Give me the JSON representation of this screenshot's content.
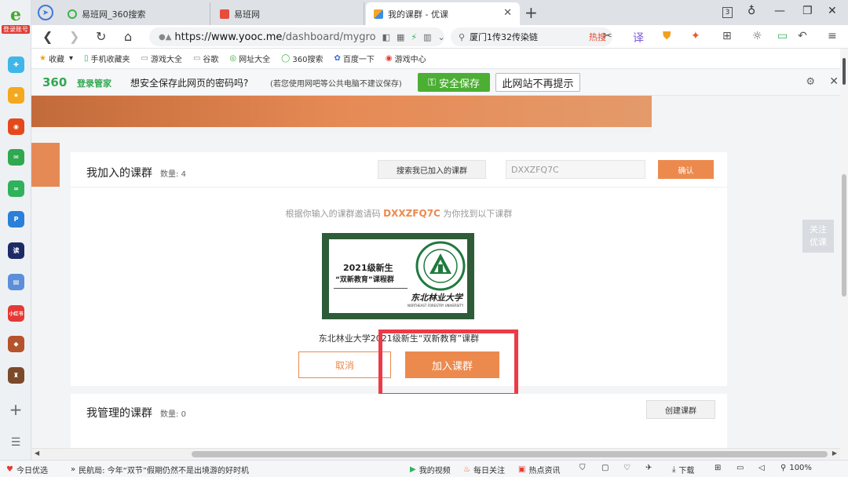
{
  "sidebar": {
    "logo_label": "登录账号",
    "apps": [
      {
        "icon": "plus-circle-icon",
        "color": "#3fb6e9",
        "glyph": "✚"
      },
      {
        "icon": "star-icon",
        "color": "#f4a81d",
        "glyph": "★"
      },
      {
        "icon": "weibo-icon",
        "color": "#e4491c",
        "glyph": "◉"
      },
      {
        "icon": "mail-icon",
        "color": "#2fa84f",
        "glyph": "✉"
      },
      {
        "icon": "cloud-icon",
        "color": "#2fb25b",
        "glyph": "∞"
      },
      {
        "icon": "p-app-icon",
        "color": "#2b7fd9",
        "glyph": "P"
      },
      {
        "icon": "news-icon",
        "color": "#1c2a66",
        "glyph": "读"
      },
      {
        "icon": "doc-icon",
        "color": "#5b8fd9",
        "glyph": "▤"
      },
      {
        "icon": "red-app-icon",
        "color": "#e53935",
        "glyph": "小红书"
      },
      {
        "icon": "game-icon",
        "color": "#b5532a",
        "glyph": "◆"
      },
      {
        "icon": "game2-icon",
        "color": "#7a4a2a",
        "glyph": "♜"
      }
    ]
  },
  "tabs": [
    {
      "title": "易班网_360搜索",
      "favicon_color": "#3db34a"
    },
    {
      "title": "易班网",
      "favicon_color": "#e94b3c"
    },
    {
      "title": "我的课群 - 优课",
      "favicon_color": "#3a8ee6"
    }
  ],
  "tab_count": "3",
  "address": {
    "scheme": "https://",
    "domain": "www.yooc.me",
    "path": "/dashboard/mygro"
  },
  "search": {
    "query": "厦门1传32传染链",
    "hot": "热搜"
  },
  "bookmarks": [
    {
      "label": "收藏",
      "icon": "star-icon"
    },
    {
      "label": "手机收藏夹",
      "icon": "phone-icon"
    },
    {
      "label": "游戏大全",
      "icon": "doc-icon"
    },
    {
      "label": "谷歌",
      "icon": "doc-icon"
    },
    {
      "label": "网址大全",
      "icon": "globe-icon"
    },
    {
      "label": "360搜索",
      "icon": "search-icon"
    },
    {
      "label": "百度一下",
      "icon": "paw-icon"
    },
    {
      "label": "游戏中心",
      "icon": "game-icon"
    }
  ],
  "password_bar": {
    "brand": "360",
    "brand_sub": "登录管家",
    "question": "想安全保存此网页的密码吗?",
    "note": "(若您使用网吧等公共电脑不建议保存)",
    "save_label": "安全保存",
    "no_more_label": "此网站不再提示"
  },
  "joined": {
    "title": "我加入的课群",
    "count_label": "数量:",
    "count": "4",
    "search_button": "搜索我已加入的课群",
    "code_value": "DXXZFQ7C",
    "confirm_button": "确认",
    "found_prefix": "根据你输入的课群邀请码",
    "found_code": "DXXZFQ7C",
    "found_suffix": "为你找到以下课群",
    "cover_line1": "2021级新生",
    "cover_line2": "“双新教育”课程群",
    "cover_university_cn": "东北林业大学",
    "cover_university_en": "NORTHEAST FORESTRY UNIVERSITY",
    "course_name": "东北林业大学2021级新生“双新教育”课群",
    "cancel_button": "取消",
    "join_button": "加入课群"
  },
  "managed": {
    "title": "我管理的课群",
    "count_label": "数量:",
    "count": "0",
    "create_button": "创建课群"
  },
  "float_button": {
    "line1": "关注",
    "line2": "优课"
  },
  "statusbar": {
    "today": "今日优选",
    "news": "民航局: 今年“双节”假期仍然不是出境游的好时机",
    "video": "我的视频",
    "daily": "每日关注",
    "hot_news": "热点资讯",
    "download": "下载",
    "zoom": "100%"
  },
  "colors": {
    "accent": "#ec8a4e",
    "highlight_box": "#ec3a48",
    "save_green": "#4caf34",
    "cover_green": "#2e5c38"
  }
}
